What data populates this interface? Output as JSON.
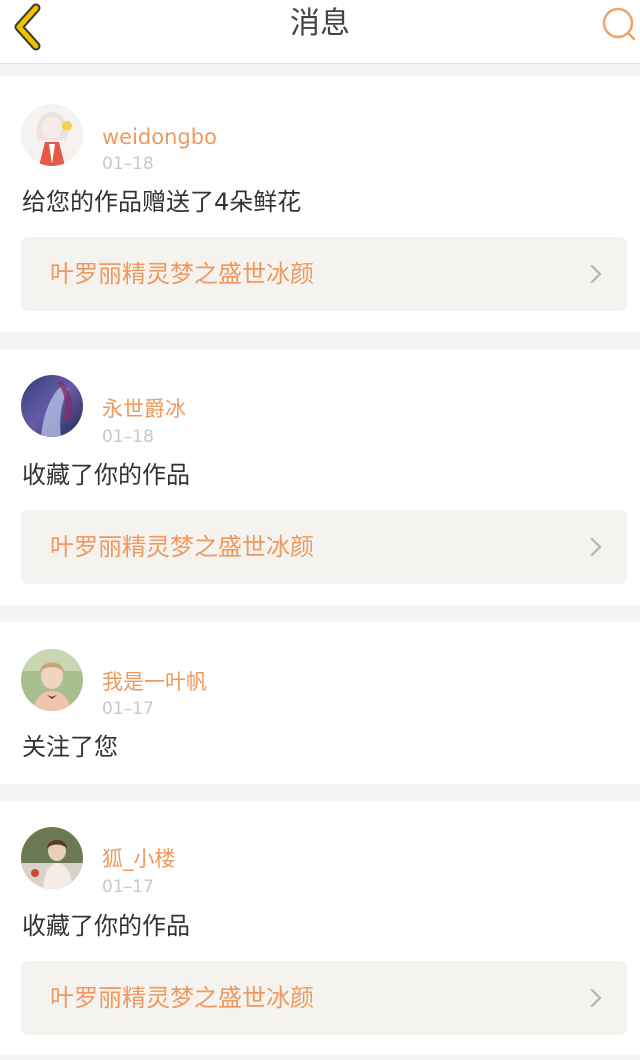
{
  "header": {
    "title": "消息",
    "back_icon": "chevron-left-icon",
    "search_icon": "search-icon",
    "accent_color": "#ee9a5e"
  },
  "messages": [
    {
      "username": "weidongbo",
      "date": "01–18",
      "action": "给您的作品赠送了4朵鲜花",
      "work_title": "叶罗丽精灵梦之盛世冰颜"
    },
    {
      "username": "永世爵冰",
      "date": "01–18",
      "action": "收藏了你的作品",
      "work_title": "叶罗丽精灵梦之盛世冰颜"
    },
    {
      "username": "我是一叶帆",
      "date": "01–17",
      "action": "关注了您"
    },
    {
      "username": "狐_小楼",
      "date": "01–17",
      "action": "收藏了你的作品",
      "work_title": "叶罗丽精灵梦之盛世冰颜"
    }
  ]
}
